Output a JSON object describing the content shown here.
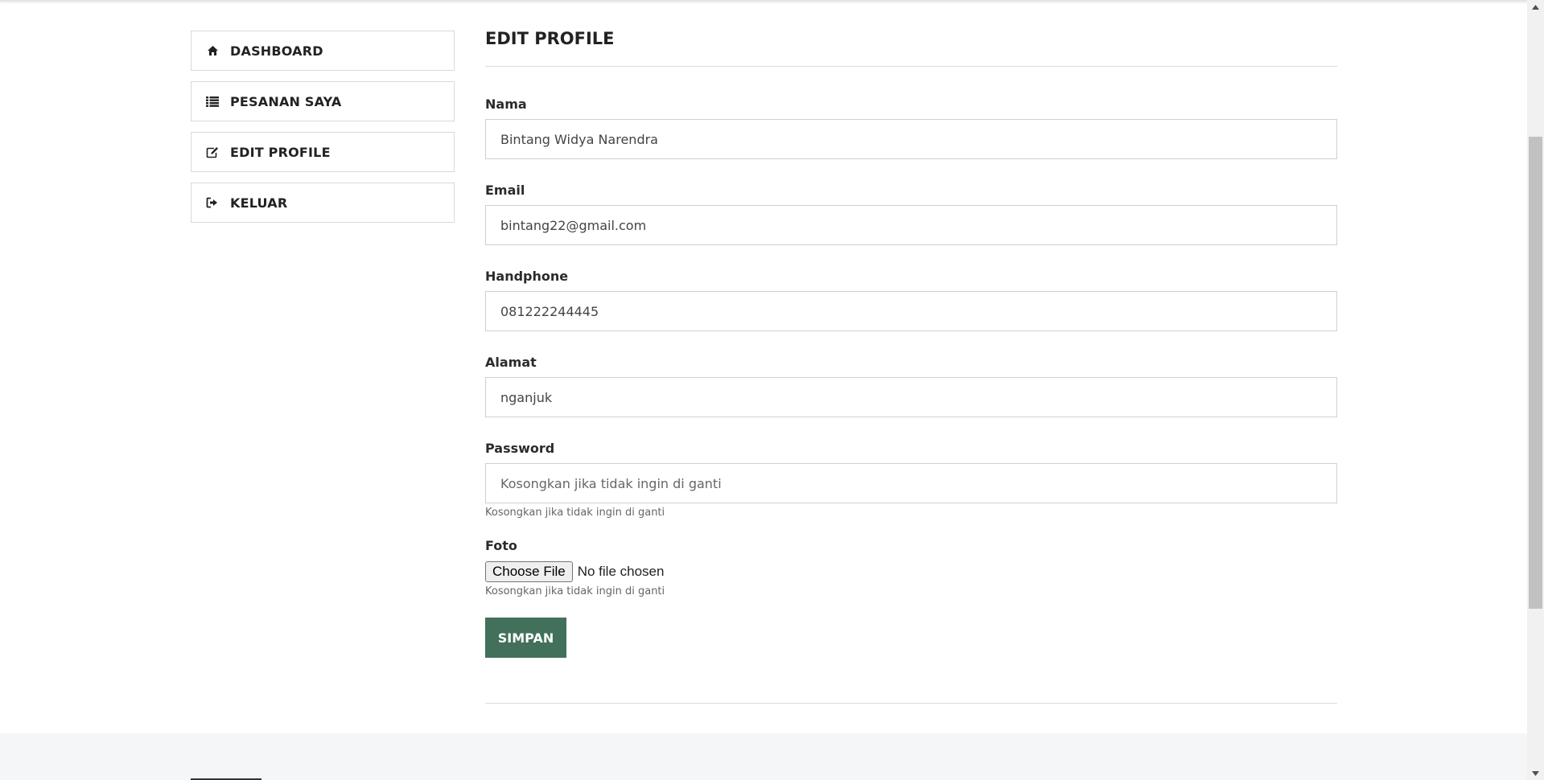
{
  "sidebar": {
    "items": [
      {
        "label": "DASHBOARD",
        "icon": "home-icon"
      },
      {
        "label": "PESANAN SAYA",
        "icon": "list-icon"
      },
      {
        "label": "EDIT PROFILE",
        "icon": "edit-icon"
      },
      {
        "label": "KELUAR",
        "icon": "sign-out-icon"
      }
    ]
  },
  "main": {
    "title": "EDIT PROFILE",
    "fields": {
      "nama": {
        "label": "Nama",
        "value": "Bintang Widya Narendra"
      },
      "email": {
        "label": "Email",
        "value": "bintang22@gmail.com"
      },
      "handphone": {
        "label": "Handphone",
        "value": "081222244445"
      },
      "alamat": {
        "label": "Alamat",
        "value": "nganjuk"
      },
      "password": {
        "label": "Password",
        "value": "",
        "placeholder": "Kosongkan jika tidak ingin di ganti",
        "help": "Kosongkan jika tidak ingin di ganti"
      },
      "foto": {
        "label": "Foto",
        "button": "Choose File",
        "status": "No file chosen",
        "help": "Kosongkan jika tidak ingin di ganti"
      }
    },
    "submit_label": "SIMPAN"
  },
  "colors": {
    "accent": "#42705a",
    "footer": "#f5f6f7"
  }
}
